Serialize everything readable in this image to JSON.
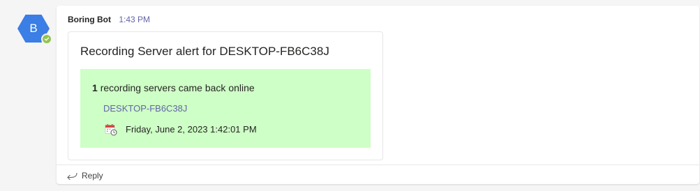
{
  "avatar": {
    "initial": "B",
    "color": "#3a7ee6",
    "presence": "available",
    "presence_color": "#92c353"
  },
  "message": {
    "sender": "Boring Bot",
    "timestamp": "1:43 PM"
  },
  "card": {
    "title": "Recording Server alert for DESKTOP-FB6C38J",
    "alert": {
      "background": "#ceffc6",
      "count": "1",
      "text": "recording servers came back online",
      "server_link": "DESKTOP-FB6C38J",
      "date_icon": "calendar-icon",
      "date": "Friday, June 2, 2023 1:42:01 PM"
    }
  },
  "footer": {
    "reply_label": "Reply",
    "reply_icon": "reply-arrow-icon"
  },
  "colors": {
    "accent": "#6264a7",
    "background": "#f5f5f5"
  }
}
